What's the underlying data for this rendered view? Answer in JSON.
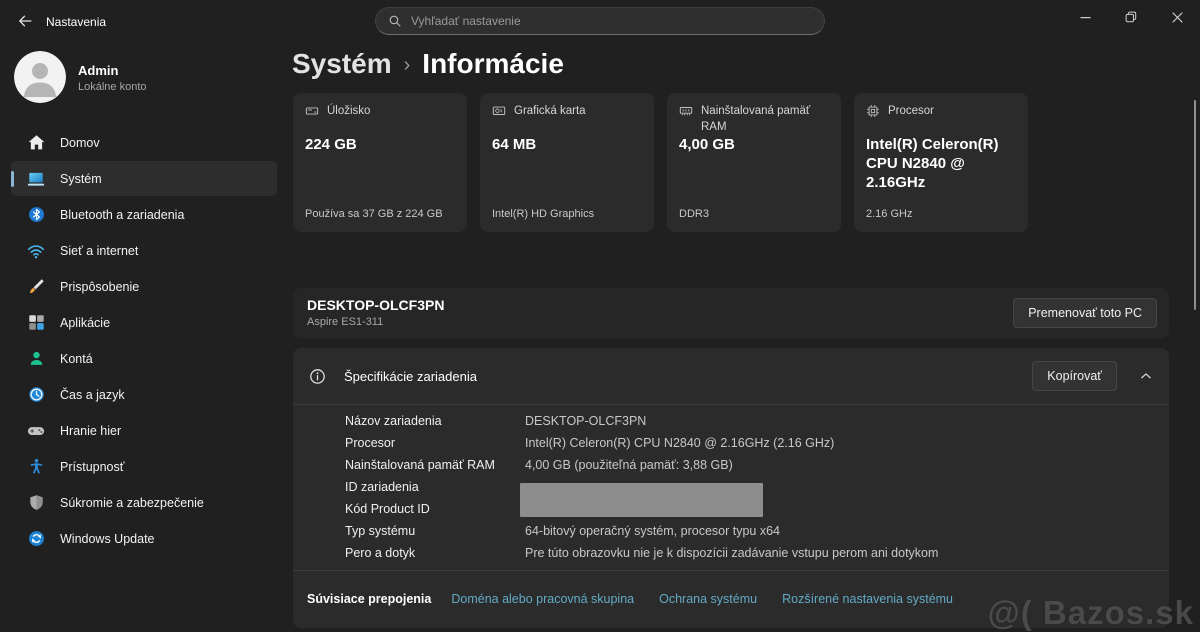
{
  "titlebar": {
    "app_title": "Nastavenia",
    "search_placeholder": "Vyhľadať nastavenie",
    "window_controls": [
      "minimize-icon",
      "restore-icon",
      "close-icon"
    ]
  },
  "account": {
    "name": "Admin",
    "type": "Lokálne konto"
  },
  "sidebar": {
    "items": [
      {
        "label": "Domov",
        "icon": "home-icon",
        "selected": false
      },
      {
        "label": "Systém",
        "icon": "system-icon",
        "selected": true
      },
      {
        "label": "Bluetooth a zariadenia",
        "icon": "bluetooth-icon",
        "selected": false
      },
      {
        "label": "Sieť a internet",
        "icon": "wifi-icon",
        "selected": false
      },
      {
        "label": "Prispôsobenie",
        "icon": "personalization-icon",
        "selected": false
      },
      {
        "label": "Aplikácie",
        "icon": "apps-icon",
        "selected": false
      },
      {
        "label": "Kontá",
        "icon": "accounts-icon",
        "selected": false
      },
      {
        "label": "Čas a jazyk",
        "icon": "time-language-icon",
        "selected": false
      },
      {
        "label": "Hranie hier",
        "icon": "gaming-icon",
        "selected": false
      },
      {
        "label": "Prístupnosť",
        "icon": "accessibility-icon",
        "selected": false
      },
      {
        "label": "Súkromie a zabezpečenie",
        "icon": "privacy-icon",
        "selected": false
      },
      {
        "label": "Windows Update",
        "icon": "windows-update-icon",
        "selected": false
      }
    ]
  },
  "breadcrumb": {
    "parent": "Systém",
    "separator": "›",
    "current": "Informácie"
  },
  "cards": [
    {
      "title": "Úložisko",
      "icon": "storage-icon",
      "value": "224 GB",
      "caption": "Používa sa 37 GB z 224 GB"
    },
    {
      "title": "Grafická karta",
      "icon": "gpu-icon",
      "value": "64 MB",
      "caption": "Intel(R) HD Graphics"
    },
    {
      "title": "Nainštalovaná pamäť RAM",
      "icon": "ram-icon",
      "value": "4,00 GB",
      "caption": "DDR3"
    },
    {
      "title": "Procesor",
      "icon": "cpu-icon",
      "value": "Intel(R) Celeron(R) CPU N2840 @ 2.16GHz",
      "caption": "2.16 GHz"
    }
  ],
  "device": {
    "name": "DESKTOP-OLCF3PN",
    "model": "Aspire ES1-311",
    "rename_button": "Premenovať toto PC"
  },
  "specs": {
    "title": "Špecifikácie zariadenia",
    "copy_button": "Kopírovať",
    "rows": [
      {
        "label": "Názov zariadenia",
        "value": "DESKTOP-OLCF3PN"
      },
      {
        "label": "Procesor",
        "value": "Intel(R) Celeron(R) CPU N2840 @ 2.16GHz (2.16 GHz)"
      },
      {
        "label": "Nainštalovaná pamäť RAM",
        "value": "4,00 GB (použiteľná pamäť: 3,88 GB)"
      },
      {
        "label": "ID zariadenia",
        "value": ""
      },
      {
        "label": "Kód Product ID",
        "value": ""
      },
      {
        "label": "Typ systému",
        "value": "64-bitový operačný systém, procesor typu x64"
      },
      {
        "label": "Pero a dotyk",
        "value": "Pre túto obrazovku nie je k dispozícii zadávanie vstupu perom ani dotykom"
      }
    ]
  },
  "related": {
    "title": "Súvisiace prepojenia",
    "links": [
      "Doména alebo pracovná skupina",
      "Ochrana systému",
      "Rozšírené nastavenia systému"
    ]
  },
  "watermark": "@( Bazos.sk",
  "colors": {
    "accent_pill": "#8ab6d6",
    "link": "#62aac6",
    "redact_box": "#8d8d8d"
  }
}
